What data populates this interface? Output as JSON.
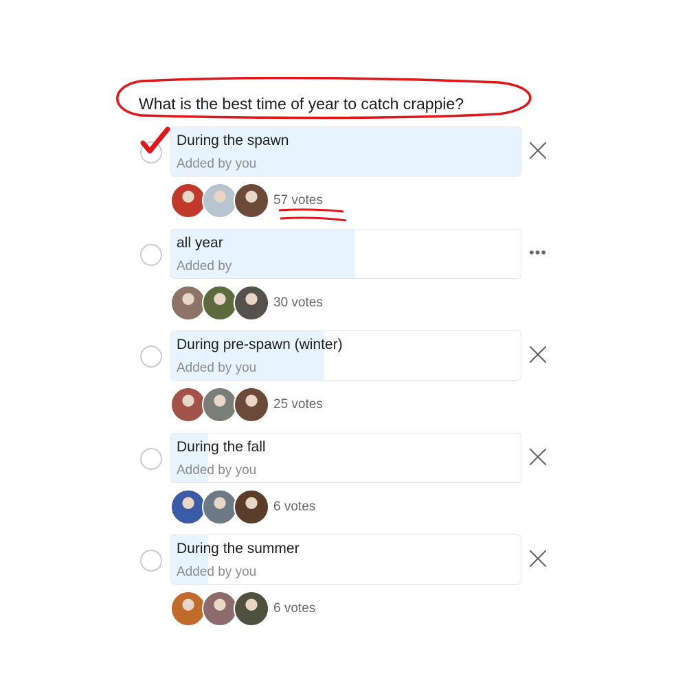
{
  "poll": {
    "question": "What is the best time of year to catch crappie?",
    "annotation_color": "#e0161b",
    "fill_color": "#e7f3ff",
    "options": [
      {
        "label": "During the spawn",
        "added_by": "Added by you",
        "votes": 57,
        "votes_label": "57 votes",
        "selected": true,
        "action": "remove",
        "action_icon": "close-icon",
        "voter_avatars": [
          "#c0392b",
          "#b8c4cf",
          "#6b4a3a"
        ]
      },
      {
        "label": "all year",
        "added_by": "Added by",
        "votes": 30,
        "votes_label": "30 votes",
        "selected": false,
        "action": "more",
        "action_icon": "more-icon",
        "voter_avatars": [
          "#8d7466",
          "#5c6b3d",
          "#55524e"
        ]
      },
      {
        "label": "During pre-spawn (winter)",
        "added_by": "Added by you",
        "votes": 25,
        "votes_label": "25 votes",
        "selected": false,
        "action": "remove",
        "action_icon": "close-icon",
        "voter_avatars": [
          "#a3524a",
          "#7a7d78",
          "#6b4a3a"
        ]
      },
      {
        "label": "During the fall",
        "added_by": "Added by you",
        "votes": 6,
        "votes_label": "6 votes",
        "selected": false,
        "action": "remove",
        "action_icon": "close-icon",
        "voter_avatars": [
          "#3b5ba5",
          "#6d7a86",
          "#5a3e2b"
        ]
      },
      {
        "label": "During the summer",
        "added_by": "Added by you",
        "votes": 6,
        "votes_label": "6 votes",
        "selected": false,
        "action": "remove",
        "action_icon": "close-icon",
        "voter_avatars": [
          "#c06a2b",
          "#8b6b6b",
          "#4e5040"
        ]
      }
    ]
  }
}
